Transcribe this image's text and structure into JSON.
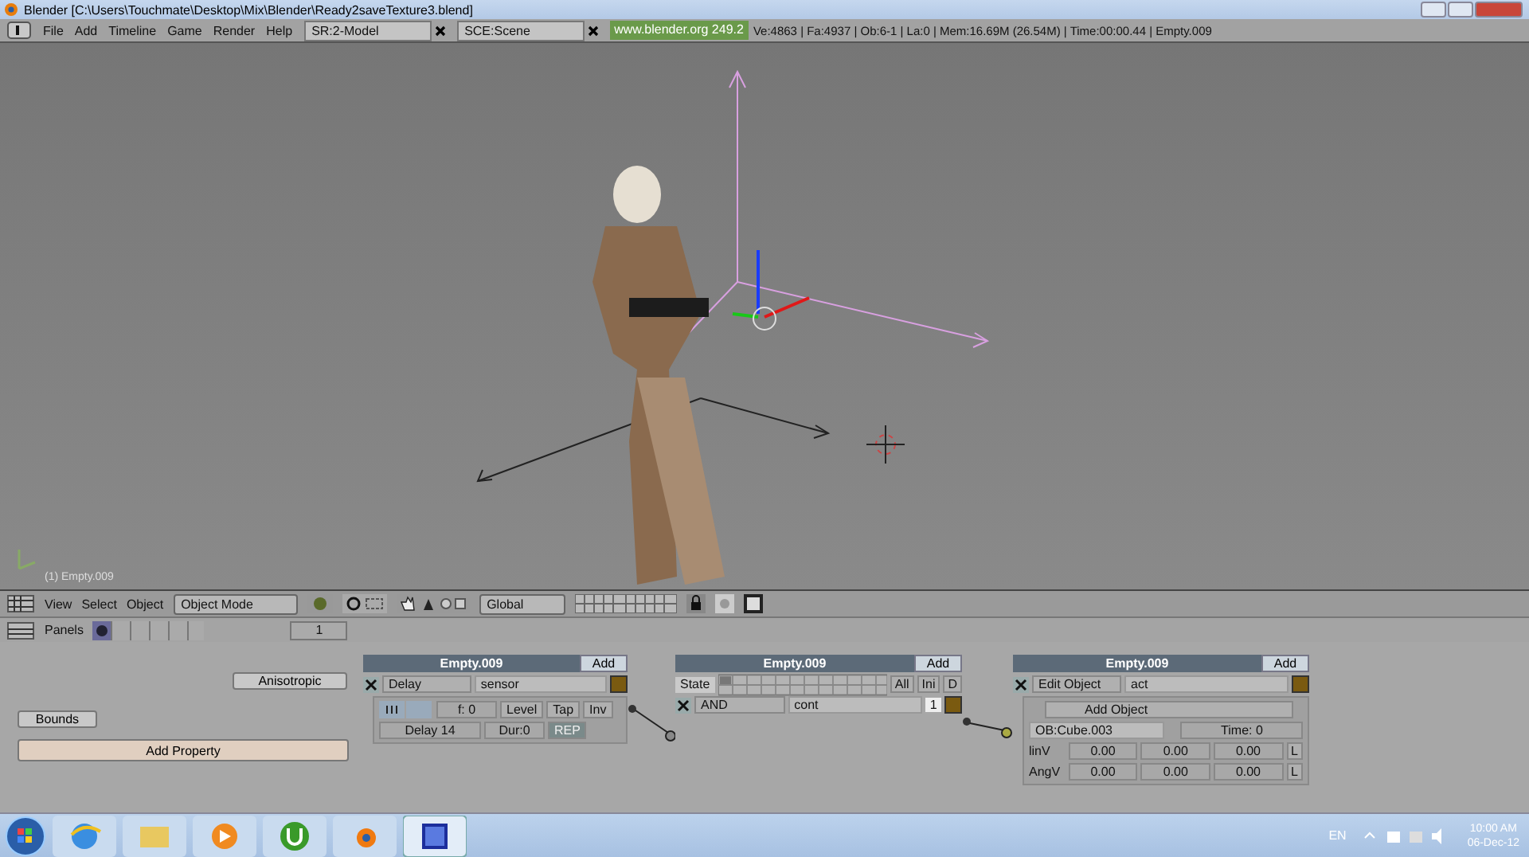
{
  "window": {
    "title": "Blender [C:\\Users\\Touchmate\\Desktop\\Mix\\Blender\\Ready2saveTexture3.blend]"
  },
  "menu": [
    "File",
    "Add",
    "Timeline",
    "Game",
    "Render",
    "Help"
  ],
  "screen_field": "SR:2-Model",
  "scene_field": "SCE:Scene",
  "link": "www.blender.org 249.2",
  "stats": "Ve:4863 | Fa:4937 | Ob:6-1 | La:0 | Mem:16.69M (26.54M) | Time:00:00.44 | Empty.009",
  "viewport": {
    "label": "(1) Empty.009"
  },
  "view_header": {
    "menus": [
      "View",
      "Select",
      "Object"
    ],
    "mode": "Object Mode",
    "orientation": "Global"
  },
  "buttons_header": {
    "label": "Panels",
    "frame": "1"
  },
  "logic": {
    "left_buttons": {
      "anisotropic": "Anisotropic",
      "bounds": "Bounds",
      "add_property": "Add Property"
    },
    "sensor": {
      "owner": "Empty.009",
      "add": "Add",
      "type": "Delay",
      "name": "sensor",
      "freq": "f: 0",
      "toggles": [
        "Level",
        "Tap",
        "Inv"
      ],
      "delay": "Delay 14",
      "dur": "Dur:0",
      "rep": "REP",
      "rep_on": true
    },
    "controller": {
      "owner": "Empty.009",
      "add": "Add",
      "state": "State",
      "state_buttons": [
        "All",
        "Ini",
        "D"
      ],
      "type": "AND",
      "name": "cont",
      "priority": "1"
    },
    "actuator": {
      "owner": "Empty.009",
      "add": "Add",
      "type": "Edit Object",
      "name": "act",
      "mode": "Add Object",
      "object": "OB:Cube.003",
      "time": "Time: 0",
      "rows": [
        {
          "label": "linV",
          "values": [
            "0.00",
            "0.00",
            "0.00"
          ],
          "local": "L"
        },
        {
          "label": "AngV",
          "values": [
            "0.00",
            "0.00",
            "0.00"
          ],
          "local": "L"
        }
      ]
    }
  },
  "taskbar": {
    "lang": "EN",
    "time": "10:00 AM",
    "date": "06-Dec-12"
  }
}
